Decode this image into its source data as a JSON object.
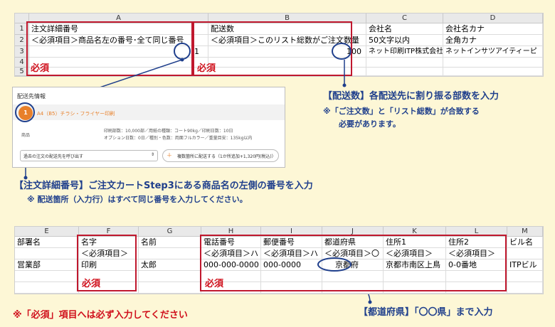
{
  "top_sheet": {
    "col_headers": [
      "A",
      "B",
      "C",
      "D"
    ],
    "row_headers": [
      "1",
      "2",
      "3",
      "4",
      "5"
    ],
    "rows": [
      [
        "注文詳細番号",
        "配送数",
        "会社名",
        "会社名カナ"
      ],
      [
        "＜必須項目＞商品名左の番号･全て同じ番号",
        "＜必須項目＞このリスト総数がご注文数量",
        "50文字以内",
        "全角カナ"
      ],
      [
        "1",
        "100",
        "ネット印刷ITP株式会社",
        "ネットインサツアイティーピ"
      ]
    ],
    "required_label_a": "必須",
    "required_label_b": "必須"
  },
  "web_card": {
    "section_title": "配送先情報",
    "badge": "1",
    "product_title": "A4（B5）チラシ・フライヤー印刷",
    "product_label": "商品",
    "detail_line1": "印刷部数：10,000部／用紙の種類：コート90kg／印刷日数：10日",
    "detail_line2": "オプション日数：0日／種別・色数：両面フルカラー／重量目安：135kg以内",
    "select_text": "過去の注文の配送先を呼び出す",
    "select_arrow": "⇕",
    "add_plus": "＋",
    "add_button_text": "複数箇所に配送する（1か所追加+1,320円(税込)）"
  },
  "notes": {
    "haisousu_title": "【配送数】各配送先に割り振る部数を入力",
    "haisousu_sub1": "※「ご注文数」と「リスト総数」が合致する",
    "haisousu_sub2": "必要があります。",
    "order_no_title": "【注文詳細番号】ご注文カートStep3にある商品名の左側の番号を入力",
    "order_no_sub": "※ 配送箇所（入力行）はすべて同じ番号を入力してください。",
    "required_note": "※「必須」項目へは必ず入力してください",
    "prefecture_note": "【都道府県】「〇〇県」まで入力"
  },
  "bottom_sheet": {
    "col_headers": [
      "E",
      "F",
      "G",
      "H",
      "I",
      "J",
      "K",
      "L",
      "M"
    ],
    "rows": [
      [
        "部署名",
        "名字",
        "名前",
        "電話番号",
        "郵便番号",
        "都道府県",
        "住所1",
        "住所2",
        "ビル名"
      ],
      [
        "",
        "＜必須項目＞",
        "",
        "＜必須項目＞ハ",
        "＜必須項目＞ハ",
        "＜必須項目＞〇",
        "＜必須項目＞",
        "＜必須項目＞",
        ""
      ],
      [
        "営業部",
        "印刷",
        "太郎",
        "000-000-0000",
        "000-0000",
        "京都府",
        "京都市南区上鳥",
        "0-0番地",
        "ITPビル"
      ]
    ],
    "required_label_f": "必須",
    "required_label_h": "必須"
  },
  "colors": {
    "red": "#c0182e",
    "blue": "#1f3f8c",
    "orange": "#e8802a",
    "background": "#fdf7d6"
  }
}
